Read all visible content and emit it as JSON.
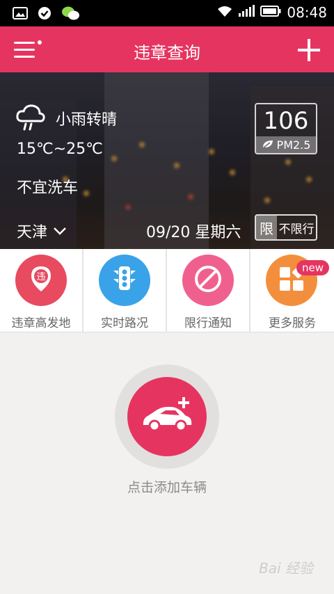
{
  "status_bar": {
    "time": "08:48",
    "icons": [
      "image-icon",
      "check-circle-icon",
      "wechat-icon",
      "wifi-icon",
      "signal-icon",
      "battery-icon"
    ]
  },
  "app_bar": {
    "title": "违章查询"
  },
  "weather": {
    "condition": "小雨转晴",
    "temperature": "15℃~25℃",
    "advice": "不宜洗车",
    "pm_value": "106",
    "pm_label": "PM2.5"
  },
  "location": {
    "city": "天津"
  },
  "date_text": "09/20 星期六",
  "restriction": {
    "tag": "限",
    "status": "不限行"
  },
  "quick_menu": [
    {
      "label": "违章高发地",
      "icon": "violation-location-icon",
      "color": "#e84a5f",
      "icon_char": "违"
    },
    {
      "label": "实时路况",
      "icon": "traffic-light-icon",
      "color": "#3aa2e8"
    },
    {
      "label": "限行通知",
      "icon": "no-entry-icon",
      "color": "#f0608e"
    },
    {
      "label": "更多服务",
      "icon": "more-services-icon",
      "color": "#f38f3c",
      "badge": "new"
    }
  ],
  "empty_state": {
    "label": "点击添加车辆"
  },
  "watermark": "Bai 经验"
}
